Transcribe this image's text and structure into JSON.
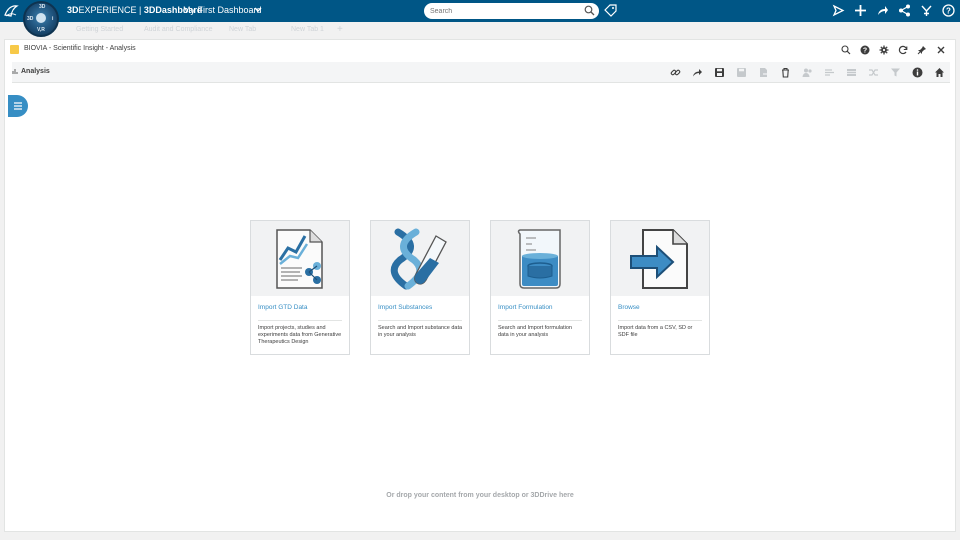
{
  "topbar": {
    "brand_strong": "3D",
    "brand_rest": "EXPERIENCE | ",
    "brand_app": "3DDashboard",
    "dashboard_title": "My First Dashboard",
    "compass": {
      "top": "3D",
      "left": "3D",
      "right": "i",
      "bottom": "V,R"
    },
    "search": {
      "placeholder": "Search"
    },
    "icons": [
      "speech-bubble-icon",
      "plus-icon",
      "share-icon",
      "network-icon",
      "compass-tool-icon",
      "help-icon"
    ]
  },
  "tabs": [
    "Getting Started",
    "Audit and Compliance",
    "New Tab",
    "New Tab 1"
  ],
  "widget": {
    "title": "BIOVIA - Scientific Insight - Analysis",
    "toolbar_label": "Analysis",
    "drop_hint": "Or drop your content from your desktop or 3DDrive here"
  },
  "cards": [
    {
      "title": "Import GTD Data",
      "description": "Import projects, studies and experiments data from Generative Therapeutics Design",
      "icon": "gtd-document-chart-icon"
    },
    {
      "title": "Import Substances",
      "description": "Search and Import substance data in your analysis",
      "icon": "dna-testtube-icon"
    },
    {
      "title": "Import Formulation",
      "description": "Search and Import formulation data in your analysis",
      "icon": "beaker-icon"
    },
    {
      "title": "Browse",
      "description": "Import data from a CSV, SD or SDF file",
      "icon": "file-import-arrow-icon"
    }
  ],
  "colors": {
    "topbar": "#005686",
    "accent": "#368ec4",
    "app_icon": "#f7c948"
  }
}
